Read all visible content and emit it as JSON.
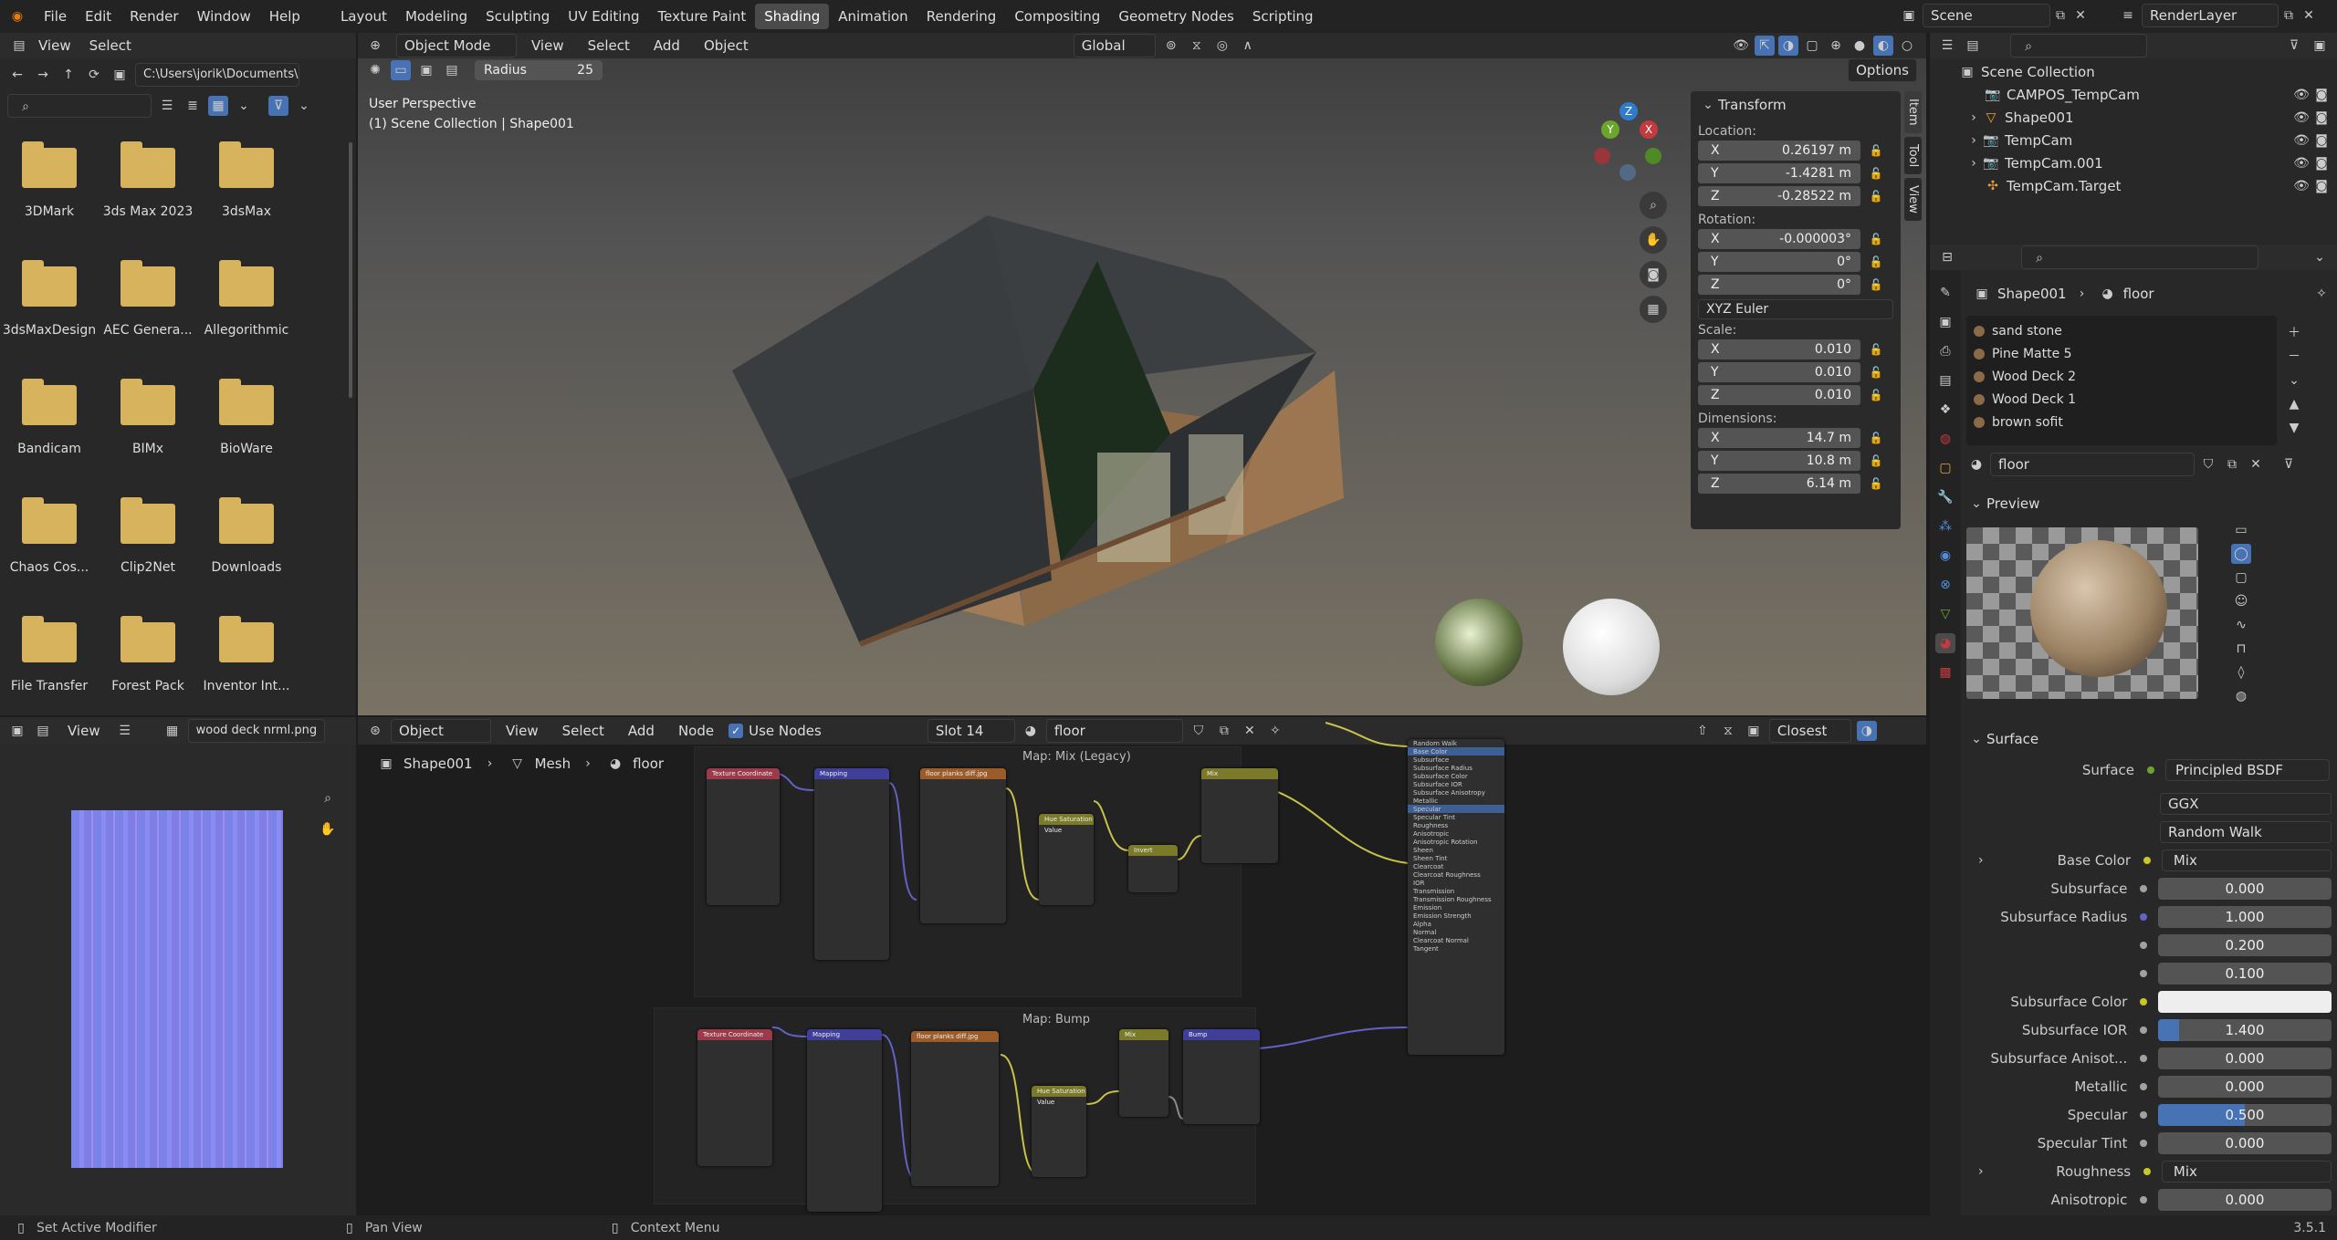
{
  "topbar": {
    "menus": [
      "File",
      "Edit",
      "Render",
      "Window",
      "Help"
    ],
    "workspaces": [
      "Layout",
      "Modeling",
      "Sculpting",
      "UV Editing",
      "Texture Paint",
      "Shading",
      "Animation",
      "Rendering",
      "Compositing",
      "Geometry Nodes",
      "Scripting"
    ],
    "active_workspace": "Shading",
    "scene": "Scene",
    "view_layer": "RenderLayer"
  },
  "file_browser": {
    "menu": [
      "View",
      "Select"
    ],
    "path": "C:\\Users\\jorik\\Documents\\",
    "items": [
      "3DMark",
      "3ds Max 2023",
      "3dsMax",
      "3dsMaxDesign",
      "AEC Genera...",
      "Allegorithmic",
      "Bandicam",
      "BIMx",
      "BioWare",
      "Chaos Cos...",
      "Clip2Net",
      "Downloads",
      "File Transfer",
      "Forest Pack",
      "Inventor Int..."
    ]
  },
  "viewport": {
    "mode": "Object Mode",
    "menu": [
      "View",
      "Select",
      "Add",
      "Object"
    ],
    "orientation": "Global",
    "radius_label": "Radius",
    "radius_value": "25",
    "options": "Options",
    "perspective": "User Perspective",
    "collection_info": "(1) Scene Collection | Shape001",
    "side_tabs": [
      "Item",
      "Tool",
      "View"
    ],
    "gizmo": {
      "x": "X",
      "y": "Y",
      "z": "Z"
    }
  },
  "transform": {
    "title": "Transform",
    "location_label": "Location:",
    "location": [
      {
        "axis": "X",
        "value": "0.26197 m"
      },
      {
        "axis": "Y",
        "value": "-1.4281 m"
      },
      {
        "axis": "Z",
        "value": "-0.28522 m"
      }
    ],
    "rotation_label": "Rotation:",
    "rotation": [
      {
        "axis": "X",
        "value": "-0.000003°"
      },
      {
        "axis": "Y",
        "value": "0°"
      },
      {
        "axis": "Z",
        "value": "0°"
      }
    ],
    "rotation_mode": "XYZ Euler",
    "scale_label": "Scale:",
    "scale": [
      {
        "axis": "X",
        "value": "0.010"
      },
      {
        "axis": "Y",
        "value": "0.010"
      },
      {
        "axis": "Z",
        "value": "0.010"
      }
    ],
    "dimensions_label": "Dimensions:",
    "dimensions": [
      {
        "axis": "X",
        "value": "14.7 m"
      },
      {
        "axis": "Y",
        "value": "10.8 m"
      },
      {
        "axis": "Z",
        "value": "6.14 m"
      }
    ]
  },
  "outliner": {
    "root": "Scene Collection",
    "items": [
      "CAMPOS_TempCam",
      "Shape001",
      "TempCam",
      "TempCam.001",
      "TempCam.Target"
    ]
  },
  "properties": {
    "breadcrumb_object": "Shape001",
    "breadcrumb_material": "floor",
    "material_slots": [
      "sand stone",
      "Pine Matte 5",
      "Wood Deck 2",
      "Wood Deck 1",
      "brown sofit"
    ],
    "material_name": "floor",
    "preview_label": "Preview",
    "surface_label": "Surface",
    "surface_shader_label": "Surface",
    "surface_shader": "Principled BSDF",
    "distribution": "GGX",
    "subsurface_method": "Random Walk",
    "rows": [
      {
        "label": "Base Color",
        "value": "Mix",
        "kind": "link"
      },
      {
        "label": "Subsurface",
        "value": "0.000",
        "kind": "num"
      },
      {
        "label": "Subsurface Radius",
        "value": "1.000",
        "kind": "num"
      },
      {
        "label": "",
        "value": "0.200",
        "kind": "num"
      },
      {
        "label": "",
        "value": "0.100",
        "kind": "num"
      },
      {
        "label": "Subsurface Color",
        "value": "",
        "kind": "color"
      },
      {
        "label": "Subsurface IOR",
        "value": "1.400",
        "kind": "num"
      },
      {
        "label": "Subsurface Anisot...",
        "value": "0.000",
        "kind": "num"
      },
      {
        "label": "Metallic",
        "value": "0.000",
        "kind": "num"
      },
      {
        "label": "Specular",
        "value": "0.500",
        "kind": "num"
      },
      {
        "label": "Specular Tint",
        "value": "0.000",
        "kind": "num"
      },
      {
        "label": "Roughness",
        "value": "Mix",
        "kind": "link"
      },
      {
        "label": "Anisotropic",
        "value": "0.000",
        "kind": "num"
      }
    ]
  },
  "image_editor": {
    "view": "View",
    "image_name": "wood deck nrml.png"
  },
  "node_editor": {
    "editor": "Object",
    "menu": [
      "View",
      "Select",
      "Add",
      "Node"
    ],
    "use_nodes": "Use Nodes",
    "slot": "Slot 14",
    "material": "floor",
    "interp": "Closest",
    "breadcrumb": [
      "Shape001",
      "Mesh",
      "floor"
    ],
    "frame_mix": "Map: Mix (Legacy)",
    "frame_bump": "Map: Bump",
    "nodes": {
      "texcoord": "Texture Coordinate",
      "mapping": "Mapping",
      "image1": "floor planks diff.jpg",
      "hsv": "Hue Saturation Value",
      "invert": "Invert",
      "mix": "Mix",
      "bump": "Bump",
      "bsdf_values": [
        "Random Walk",
        "Base Color",
        "Subsurface",
        "Subsurface Radius",
        "Subsurface Color",
        "Subsurface IOR",
        "Subsurface Anisotropy",
        "Metallic",
        "Specular",
        "Specular Tint",
        "Roughness",
        "Anisotropic",
        "Anisotropic Rotation",
        "Sheen",
        "Sheen Tint",
        "Clearcoat",
        "Clearcoat Roughness",
        "IOR",
        "Transmission",
        "Transmission Roughness",
        "Emission",
        "Emission Strength",
        "Alpha",
        "Normal",
        "Clearcoat Normal",
        "Tangent"
      ]
    }
  },
  "status_bar": {
    "left": "Set Active Modifier",
    "middle": "Pan View",
    "right": "Context Menu",
    "version": "3.5.1"
  },
  "colors": {
    "accent": "#4772b3",
    "active_tab": "#4b4b4b",
    "folder": "#d8b35e"
  }
}
